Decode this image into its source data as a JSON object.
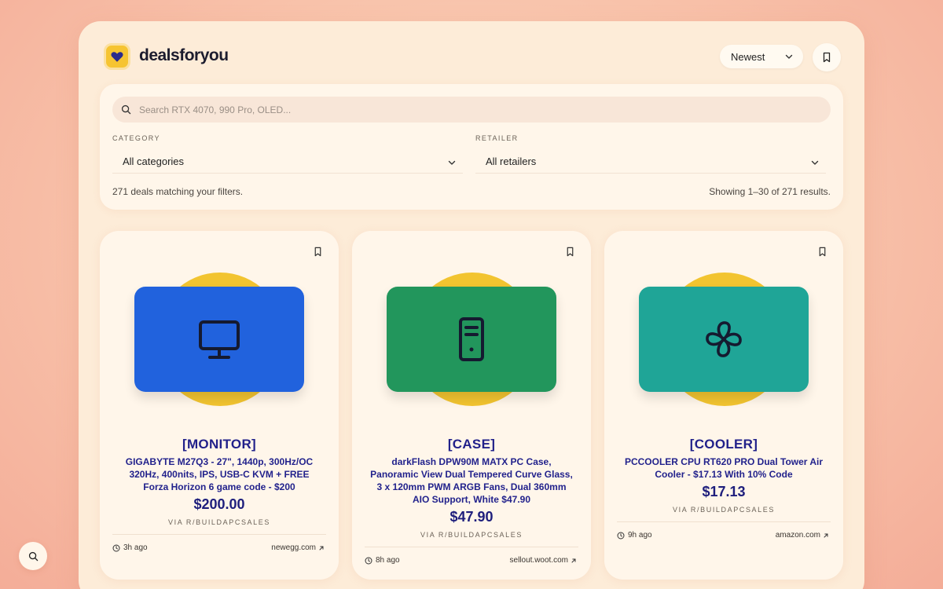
{
  "header": {
    "brand": "dealsforyou",
    "logo_icon": "heart-icon",
    "sort": {
      "selected": "Newest",
      "icon": "chevron-down-icon"
    },
    "bookmark_icon": "bookmark-icon"
  },
  "filters": {
    "search": {
      "value": "",
      "placeholder": "Search RTX 4070, 990 Pro, OLED...",
      "icon": "search-icon"
    },
    "category": {
      "label": "CATEGORY",
      "selected": "All categories"
    },
    "retailer": {
      "label": "RETAILER",
      "selected": "All retailers"
    },
    "match_count": "271 deals matching your filters.",
    "showing": "Showing 1–30 of 271 results."
  },
  "cards": [
    {
      "category": "[MONITOR]",
      "title": "GIGABYTE M27Q3 - 27\", 1440p, 300Hz/OC 320Hz, 400nits, IPS, USB-C KVM + FREE Forza Horizon 6 game code - $200",
      "price": "$200.00",
      "source": "VIA R/BUILDAPCSALES",
      "time": "3h ago",
      "retailer": "newegg.com",
      "icon": "monitor-icon",
      "tile_color": "#2162dd"
    },
    {
      "category": "[CASE]",
      "title": "darkFlash DPW90M MATX PC Case, Panoramic View Dual Tempered Curve Glass, 3 x 120mm PWM ARGB Fans, Dual 360mm AIO Support, White $47.90",
      "price": "$47.90",
      "source": "VIA R/BUILDAPCSALES",
      "time": "8h ago",
      "retailer": "sellout.woot.com",
      "icon": "pc-case-icon",
      "tile_color": "#22965c"
    },
    {
      "category": "[COOLER]",
      "title": "PCCOOLER CPU RT620 PRO Dual Tower Air Cooler - $17.13 With 10% Code",
      "price": "$17.13",
      "source": "VIA R/BUILDAPCSALES",
      "time": "9h ago",
      "retailer": "amazon.com",
      "icon": "fan-icon",
      "tile_color": "#1fa597"
    }
  ],
  "fab": {
    "icon": "search-icon"
  },
  "colors": {
    "accent_yellow": "#f2c430",
    "title_navy": "#22228c",
    "panel_bg": "#fdecd8"
  }
}
